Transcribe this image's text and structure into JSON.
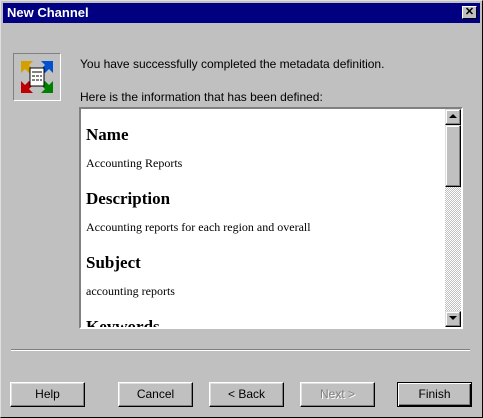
{
  "window": {
    "title": "New Channel",
    "close_glyph": "✕"
  },
  "icon": "channel-wizard-icon",
  "intro": "You have successfully completed the metadata definition.",
  "defined_label": "Here is the information that has been defined:",
  "summary": {
    "sections": [
      {
        "heading": "Name",
        "value": "Accounting Reports"
      },
      {
        "heading": "Description",
        "value": "Accounting reports for each region and overall"
      },
      {
        "heading": "Subject",
        "value": "accounting reports"
      },
      {
        "heading": "Keywords",
        "value": ""
      }
    ],
    "scroll_position": 0
  },
  "buttons": {
    "help": "Help",
    "cancel": "Cancel",
    "back": "< Back",
    "next": "Next >",
    "finish": "Finish"
  },
  "colors": {
    "titlebar": "#000080",
    "face": "#c0c0c0"
  }
}
